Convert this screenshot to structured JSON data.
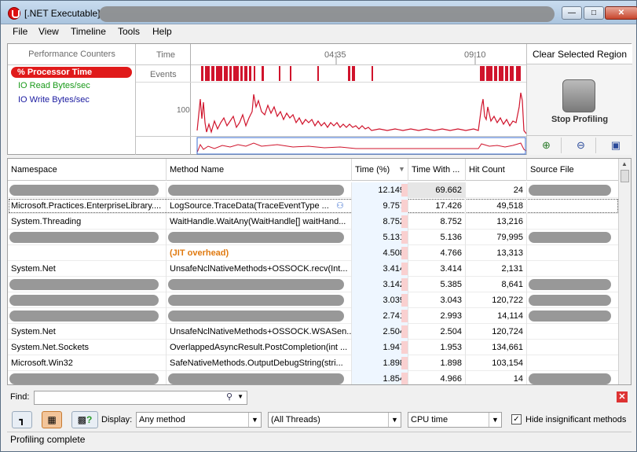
{
  "window": {
    "title": "[.NET Executable]"
  },
  "menu": [
    "File",
    "View",
    "Timeline",
    "Tools",
    "Help"
  ],
  "perf": {
    "header_counters": "Performance Counters",
    "header_time": "Time",
    "time_marks": [
      "04:35",
      "09:10"
    ],
    "events_label": "Events",
    "axis_100": "100",
    "counters": [
      {
        "label": "% Processor Time",
        "color": "#ffffff",
        "selected": true
      },
      {
        "label": "IO Read Bytes/sec",
        "color": "#1a9a1a",
        "selected": false
      },
      {
        "label": "IO Write Bytes/sec",
        "color": "#1a1aa0",
        "selected": false
      }
    ],
    "clear_label": "Clear Selected Region",
    "stop_label": "Stop Profiling",
    "accent": "#d0142c"
  },
  "grid": {
    "headers": [
      "Namespace",
      "Method Name",
      "Time (%)",
      "Time With ...",
      "Hit Count",
      "Source File"
    ],
    "rows": [
      {
        "ns": "",
        "method": "",
        "time": "12.149",
        "with": "69.662",
        "hits": "24",
        "src": "",
        "ns_blur": true,
        "method_blur": true,
        "src_blur": true,
        "hl": true
      },
      {
        "ns": "Microsoft.Practices.EnterpriseLibrary....",
        "method": "LogSource.TraceData(TraceEventType ...",
        "time": "9.757",
        "with": "17.426",
        "hits": "49,518",
        "src": "",
        "selected": true
      },
      {
        "ns": "System.Threading",
        "method": "WaitHandle.WaitAny(WaitHandle[] waitHand...",
        "time": "8.752",
        "with": "8.752",
        "hits": "13,216",
        "src": ""
      },
      {
        "ns": "",
        "method": "",
        "time": "5.131",
        "with": "5.136",
        "hits": "79,995",
        "src": "",
        "ns_blur": true,
        "method_blur": true,
        "src_blur": true
      },
      {
        "ns": "",
        "method": "(JIT overhead)",
        "time": "4.508",
        "with": "4.766",
        "hits": "13,313",
        "src": "",
        "jit": true
      },
      {
        "ns": "System.Net",
        "method": "UnsafeNclNativeMethods+OSSOCK.recv(Int...",
        "time": "3.414",
        "with": "3.414",
        "hits": "2,131",
        "src": ""
      },
      {
        "ns": "",
        "method": "",
        "time": "3.142",
        "with": "5.385",
        "hits": "8,641",
        "src": "",
        "ns_blur": true,
        "method_blur": true,
        "src_blur": true
      },
      {
        "ns": "",
        "method": "",
        "time": "3.039",
        "with": "3.043",
        "hits": "120,722",
        "src": "",
        "ns_blur": true,
        "method_blur": true,
        "src_blur": true
      },
      {
        "ns": "",
        "method": "",
        "time": "2.741",
        "with": "2.993",
        "hits": "14,114",
        "src": "",
        "ns_blur": true,
        "method_blur": true,
        "src_blur": true
      },
      {
        "ns": "System.Net",
        "method": "UnsafeNclNativeMethods+OSSOCK.WSASen...",
        "time": "2.504",
        "with": "2.504",
        "hits": "120,724",
        "src": ""
      },
      {
        "ns": "System.Net.Sockets",
        "method": "OverlappedAsyncResult.PostCompletion(int ...",
        "time": "1.947",
        "with": "1.953",
        "hits": "134,661",
        "src": ""
      },
      {
        "ns": "Microsoft.Win32",
        "method": "SafeNativeMethods.OutputDebugString(stri...",
        "time": "1.898",
        "with": "1.898",
        "hits": "103,154",
        "src": ""
      },
      {
        "ns": "",
        "method": "",
        "time": "1.854",
        "with": "4.966",
        "hits": "14",
        "src": "",
        "ns_blur": true,
        "method_blur": true,
        "src_blur": true
      }
    ]
  },
  "find": {
    "label": "Find:",
    "value": ""
  },
  "display": {
    "label": "Display:",
    "method_filter": "Any method",
    "threads": "(All Threads)",
    "time_mode": "CPU time",
    "hide_insignificant_label": "Hide insignificant methods",
    "hide_insignificant_checked": true
  },
  "status": {
    "text": "Profiling complete"
  }
}
